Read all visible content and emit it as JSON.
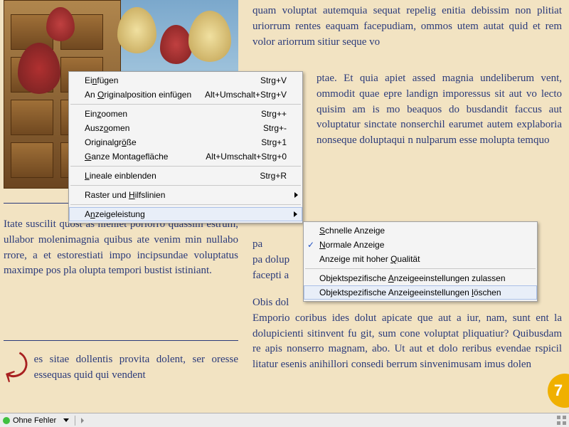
{
  "body": {
    "left_p1": "Itate suscilit",
    "left_p2": "quost as nieniet poriorro quassim estrum, ullabor molenimagnia quibus ate venim min nullabo rrore, a et estorestiati impo incipsundae voluptatus maximpe pos pla olupta tempori bustist istiniant.",
    "drop_letter": "↘",
    "drop_text": "es sitae dollentis provita dolent, ser oresse essequas quid qui vendent",
    "right_p1": "quam voluptat autemquia sequat repelig enitia debissim non plitiat uriorrum rentes eaquam facepudiam, ommos utem autat quid et rem volor ariorrum sitiur seque vo",
    "right_p1b": "ptae. Et quia apiet assed magnia undeliberum vent, ommodit quae epre landign imporessus sit aut vo lecto quisim am is mo beaquos do busdandit faccus aut voluptatur sinctate nonserchil earumet autem explaboria nonseque doluptaqui n nulparum esse molupta temquo",
    "right_p2a": "pa",
    "right_p2b": "pa dolup",
    "right_p2c": "facepti a",
    "right_p3": "Obis dol",
    "right_p3b": "Emporio coribus ides dolut apicate que aut a iur, nam, sunt ent la dolupicienti sitinvent fu git, sum cone voluptat pliquatiur? Quibusdam re apis nonserro magnam, abo. Ut aut et dolo reribus evendae rspicil litatur esenis anihillori consedi berrum sinvenimusam imus dolen"
  },
  "menu": {
    "items": [
      {
        "label_html": "Ei<u>n</u>fügen",
        "shortcut": "Strg+V"
      },
      {
        "label_html": "An <u>O</u>riginalposition einfügen",
        "shortcut": "Alt+Umschalt+Strg+V"
      },
      {
        "sep": true
      },
      {
        "label_html": "Ein<u>z</u>oomen",
        "shortcut": "Strg++"
      },
      {
        "label_html": "Ausz<u>o</u>omen",
        "shortcut": "Strg+-"
      },
      {
        "label_html": "Originalgr<u>ö</u>ße",
        "shortcut": "Strg+1"
      },
      {
        "label_html": "<u>G</u>anze Montagefläche",
        "shortcut": "Alt+Umschalt+Strg+0"
      },
      {
        "sep": true
      },
      {
        "label_html": "<u>L</u>ineale einblenden",
        "shortcut": "Strg+R"
      },
      {
        "sep": true
      },
      {
        "label_html": "Raster und <u>H</u>ilfslinien",
        "arrow": true
      },
      {
        "sep": true
      },
      {
        "label_html": "A<u>n</u>zeigeleistung",
        "arrow": true,
        "hover": true
      }
    ],
    "sub": [
      {
        "label_html": "<u>S</u>chnelle Anzeige"
      },
      {
        "label_html": "<u>N</u>ormale Anzeige",
        "checked": true
      },
      {
        "label_html": "Anzeige mit hoher <u>Q</u>ualität"
      },
      {
        "sep": true
      },
      {
        "label_html": "Objektspezifische <u>A</u>nzeigeeinstellungen zulassen"
      },
      {
        "label_html": "Objektspezifische Anzeigeeinstellungen <u>l</u>öschen",
        "hover": true
      }
    ]
  },
  "status": {
    "text": "Ohne Fehler"
  },
  "page_number": "7"
}
